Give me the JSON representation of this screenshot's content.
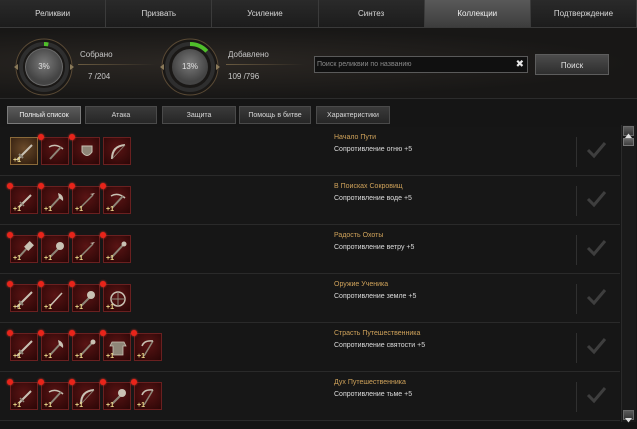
{
  "tabs": [
    {
      "label": "Реликвии"
    },
    {
      "label": "Призвать"
    },
    {
      "label": "Усиление"
    },
    {
      "label": "Синтез"
    },
    {
      "label": "Коллекции",
      "active": true
    },
    {
      "label": "Подтверждение"
    }
  ],
  "stats": {
    "collected": {
      "label": "Собрано",
      "percent_text": "3%",
      "count": "7 /204",
      "progress": 0.03
    },
    "added": {
      "label": "Добавлено",
      "percent_text": "13%",
      "count": "109 /796",
      "progress": 0.13
    }
  },
  "search": {
    "placeholder": "Поиск реликвии по названию",
    "value": "",
    "button_label": "Поиск",
    "clear_icon": "close-icon"
  },
  "filters": [
    {
      "label": "Полный список",
      "active": true
    },
    {
      "label": "Атака"
    },
    {
      "label": "Защита"
    },
    {
      "label": "Помощь в битве"
    },
    {
      "label": "Характеристики"
    }
  ],
  "colors": {
    "accent_gold": "#cfa25a",
    "gauge_green": "#4fbf2a",
    "red_dot": "#e8241a"
  },
  "collections": [
    {
      "title": "Начало Пути",
      "bonus": "Сопротивление огню +5",
      "items": [
        {
          "icon": "sword-icon",
          "level": "+1",
          "owned": true,
          "new": false
        },
        {
          "icon": "crossbow-icon",
          "level": "",
          "owned": false,
          "new": true
        },
        {
          "icon": "shield-icon",
          "level": "",
          "owned": false,
          "new": true
        },
        {
          "icon": "bow-icon",
          "level": "",
          "owned": false,
          "new": false
        }
      ]
    },
    {
      "title": "В Поисках Сокровищ",
      "bonus": "Сопротивление воде +5",
      "items": [
        {
          "icon": "dagger-icon",
          "level": "+1",
          "owned": false,
          "new": true
        },
        {
          "icon": "axe-icon",
          "level": "+1",
          "owned": false,
          "new": true
        },
        {
          "icon": "spear-icon",
          "level": "+1",
          "owned": false,
          "new": true
        },
        {
          "icon": "crossbow-icon",
          "level": "+1",
          "owned": false,
          "new": true
        }
      ]
    },
    {
      "title": "Радость Охоты",
      "bonus": "Сопротивление ветру +5",
      "items": [
        {
          "icon": "hammer-icon",
          "level": "+1",
          "owned": false,
          "new": true
        },
        {
          "icon": "mace-icon",
          "level": "+1",
          "owned": false,
          "new": true
        },
        {
          "icon": "spear-icon",
          "level": "+1",
          "owned": false,
          "new": true
        },
        {
          "icon": "staff-icon",
          "level": "+1",
          "owned": false,
          "new": true
        }
      ]
    },
    {
      "title": "Оружие Ученика",
      "bonus": "Сопротивление земле +5",
      "items": [
        {
          "icon": "sword-icon",
          "level": "+1",
          "owned": false,
          "new": true
        },
        {
          "icon": "wand-icon",
          "level": "+1",
          "owned": false,
          "new": true
        },
        {
          "icon": "mace-icon",
          "level": "+1",
          "owned": false,
          "new": true
        },
        {
          "icon": "wheel-icon",
          "level": "+1",
          "owned": false,
          "new": true
        }
      ]
    },
    {
      "title": "Страсть Путешественника",
      "bonus": "Сопротивление святости +5",
      "items": [
        {
          "icon": "sword-icon",
          "level": "+1",
          "owned": false,
          "new": true
        },
        {
          "icon": "axe-icon",
          "level": "+1",
          "owned": false,
          "new": true
        },
        {
          "icon": "staff-icon",
          "level": "+1",
          "owned": false,
          "new": true
        },
        {
          "icon": "armor-icon",
          "level": "+1",
          "owned": false,
          "new": true
        },
        {
          "icon": "scythe-icon",
          "level": "+1",
          "owned": false,
          "new": true
        }
      ]
    },
    {
      "title": "Дух Путешественника",
      "bonus": "Сопротивление тьме +5",
      "items": [
        {
          "icon": "dagger-icon",
          "level": "+1",
          "owned": false,
          "new": true
        },
        {
          "icon": "crossbow-icon",
          "level": "+1",
          "owned": false,
          "new": true
        },
        {
          "icon": "bow-icon",
          "level": "+1",
          "owned": false,
          "new": true
        },
        {
          "icon": "mace-icon",
          "level": "+1",
          "owned": false,
          "new": true
        },
        {
          "icon": "scythe-icon",
          "level": "+1",
          "owned": false,
          "new": true
        }
      ]
    }
  ]
}
